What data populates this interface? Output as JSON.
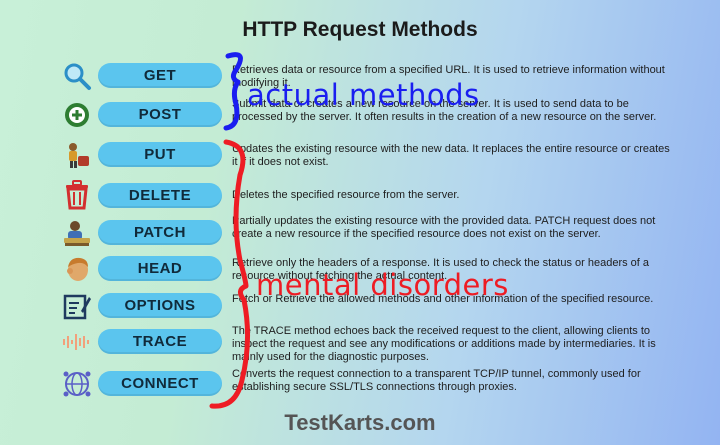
{
  "title": "HTTP Request Methods",
  "methods": [
    {
      "name": "GET",
      "icon": "magnifier-icon",
      "description": "Retrieves data or resource from a specified URL. It is used to retrieve information without modifying it."
    },
    {
      "name": "POST",
      "icon": "plus-icon",
      "description": "Submit data or creates a new resource on the server. It is used to send data to be processed by the server. It often results in the creation of a new resource on the server."
    },
    {
      "name": "PUT",
      "icon": "worker-icon",
      "description": "Updates the existing resource with the new data. It replaces the entire resource or creates it if it does not exist."
    },
    {
      "name": "DELETE",
      "icon": "trash-icon",
      "description": "Deletes the specified resource from the server."
    },
    {
      "name": "PATCH",
      "icon": "reading-person-icon",
      "description": "Partially updates the existing resource with the provided data. PATCH request does not create a new resource if the specified resource does not exist on the server."
    },
    {
      "name": "HEAD",
      "icon": "head-icon",
      "description": "Retrieve only the headers of a response. It is used to check the status or headers of a resource without fetching the actual content."
    },
    {
      "name": "OPTIONS",
      "icon": "edit-document-icon",
      "description": "Fetch or Retrieve the allowed methods and other information of the specified resource."
    },
    {
      "name": "TRACE",
      "icon": "waveform-icon",
      "description": "The TRACE method echoes back the received request to the client, allowing clients to inspect the request and see any modifications or additions made by intermediaries. It is mainly used for the diagnostic purposes."
    },
    {
      "name": "CONNECT",
      "icon": "network-globe-icon",
      "description": "Converts the request connection to a transparent TCP/IP tunnel, commonly used for establishing secure SSL/TLS connections through proxies."
    }
  ],
  "annotations": {
    "top": "actual methods",
    "bottom": "mental disorders"
  },
  "footer": "TestKarts.com",
  "colors": {
    "pill": "#5bc5ee",
    "annotation_blue": "#1a1ef0",
    "annotation_red": "#ee1c24"
  }
}
